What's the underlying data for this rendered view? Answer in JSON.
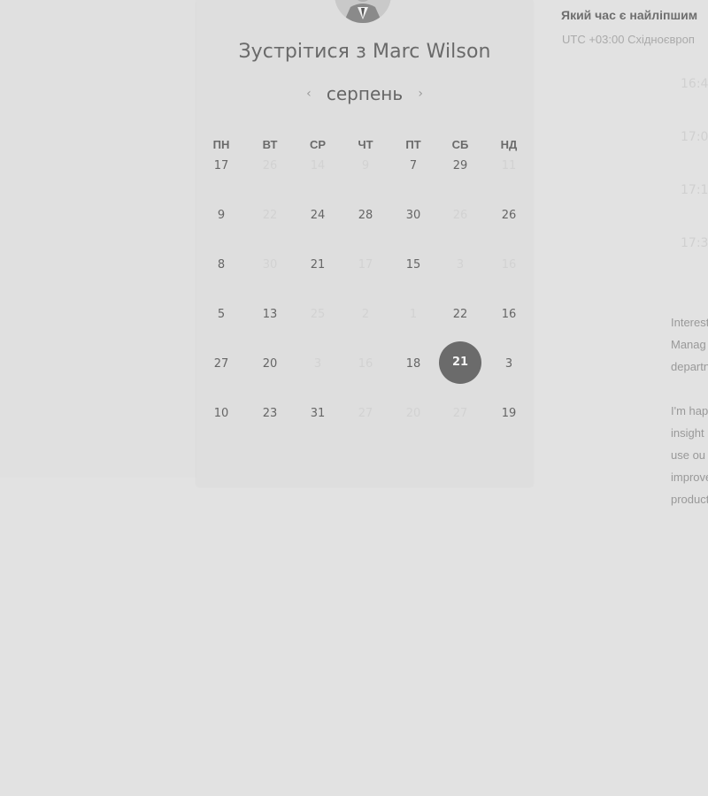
{
  "title": {
    "prefix": "Зустрітися з",
    "name": "Marc Wilson"
  },
  "calendar": {
    "month": "серпень",
    "prev_icon": "chevron-left-icon",
    "next_icon": "chevron-right-icon",
    "weekdays": [
      "ПН",
      "ВТ",
      "СР",
      "ЧТ",
      "ПТ",
      "СБ",
      "НД"
    ],
    "weeks": [
      [
        {
          "d": "17",
          "f": false
        },
        {
          "d": "26",
          "f": true
        },
        {
          "d": "14",
          "f": true
        },
        {
          "d": "9",
          "f": true
        },
        {
          "d": "7",
          "f": false
        },
        {
          "d": "29",
          "f": false
        },
        {
          "d": "11",
          "f": true
        }
      ],
      [
        {
          "d": "9",
          "f": false
        },
        {
          "d": "22",
          "f": true
        },
        {
          "d": "24",
          "f": false
        },
        {
          "d": "28",
          "f": false
        },
        {
          "d": "30",
          "f": false
        },
        {
          "d": "26",
          "f": true
        },
        {
          "d": "26",
          "f": false
        }
      ],
      [
        {
          "d": "8",
          "f": false
        },
        {
          "d": "30",
          "f": true
        },
        {
          "d": "21",
          "f": false
        },
        {
          "d": "17",
          "f": true
        },
        {
          "d": "15",
          "f": false
        },
        {
          "d": "3",
          "f": true
        },
        {
          "d": "16",
          "f": true
        }
      ],
      [
        {
          "d": "5",
          "f": false
        },
        {
          "d": "13",
          "f": false
        },
        {
          "d": "25",
          "f": true
        },
        {
          "d": "2",
          "f": true
        },
        {
          "d": "1",
          "f": true
        },
        {
          "d": "22",
          "f": false
        },
        {
          "d": "16",
          "f": false
        }
      ],
      [
        {
          "d": "27",
          "f": false
        },
        {
          "d": "20",
          "f": false
        },
        {
          "d": "3",
          "f": true
        },
        {
          "d": "16",
          "f": true
        },
        {
          "d": "18",
          "f": false
        },
        {
          "d": "21",
          "f": false,
          "selected": true
        },
        {
          "d": "3",
          "f": false
        }
      ],
      [
        {
          "d": "10",
          "f": false
        },
        {
          "d": "23",
          "f": false
        },
        {
          "d": "31",
          "f": false
        },
        {
          "d": "27",
          "f": true
        },
        {
          "d": "20",
          "f": true
        },
        {
          "d": "27",
          "f": true
        },
        {
          "d": "19",
          "f": false
        }
      ]
    ]
  },
  "right_panel": {
    "question": "Який час є найліпшим",
    "timezone": "UTC +03:00 Східноєвроп",
    "slots": [
      "16:4",
      "17:0",
      "17:1",
      "17:3"
    ],
    "description": {
      "para1": [
        "Interest",
        "Manag",
        "departn"
      ],
      "para2": [
        "I'm hap",
        "insight",
        "use ou",
        "improve",
        "product"
      ]
    }
  }
}
